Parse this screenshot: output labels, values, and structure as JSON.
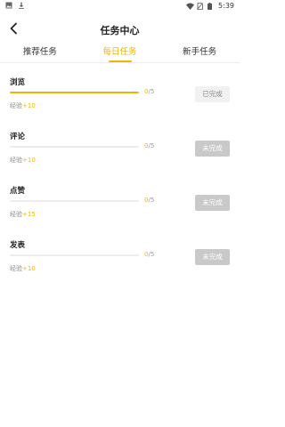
{
  "status_bar": {
    "icons": [
      "image-icon",
      "download-icon",
      "wifi-icon",
      "no-sim-icon",
      "battery-icon"
    ],
    "time": "5:39"
  },
  "header": {
    "back_icon": "chevron-left-icon",
    "title": "任务中心"
  },
  "tabs": [
    {
      "label": "推荐任务",
      "active": false
    },
    {
      "label": "每日任务",
      "active": true
    },
    {
      "label": "新手任务",
      "active": false
    }
  ],
  "colors": {
    "accent": "#f2b600",
    "incomplete_button": "#c9c9c9",
    "complete_button": "#f1f1f1"
  },
  "tasks": [
    {
      "name": "浏览",
      "done": "0",
      "total": "5",
      "progress_fraction": 1.0,
      "exp_label": "经验",
      "exp_value": "+10",
      "status": "已完成",
      "completed": true
    },
    {
      "name": "评论",
      "done": "0",
      "total": "5",
      "progress_fraction": 0.0,
      "exp_label": "经验",
      "exp_value": "+10",
      "status": "未完成",
      "completed": false
    },
    {
      "name": "点赞",
      "done": "0",
      "total": "5",
      "progress_fraction": 0.0,
      "exp_label": "经验",
      "exp_value": "+15",
      "status": "未完成",
      "completed": false
    },
    {
      "name": "发表",
      "done": "0",
      "total": "5",
      "progress_fraction": 0.0,
      "exp_label": "经验",
      "exp_value": "+10",
      "status": "未完成",
      "completed": false
    }
  ]
}
